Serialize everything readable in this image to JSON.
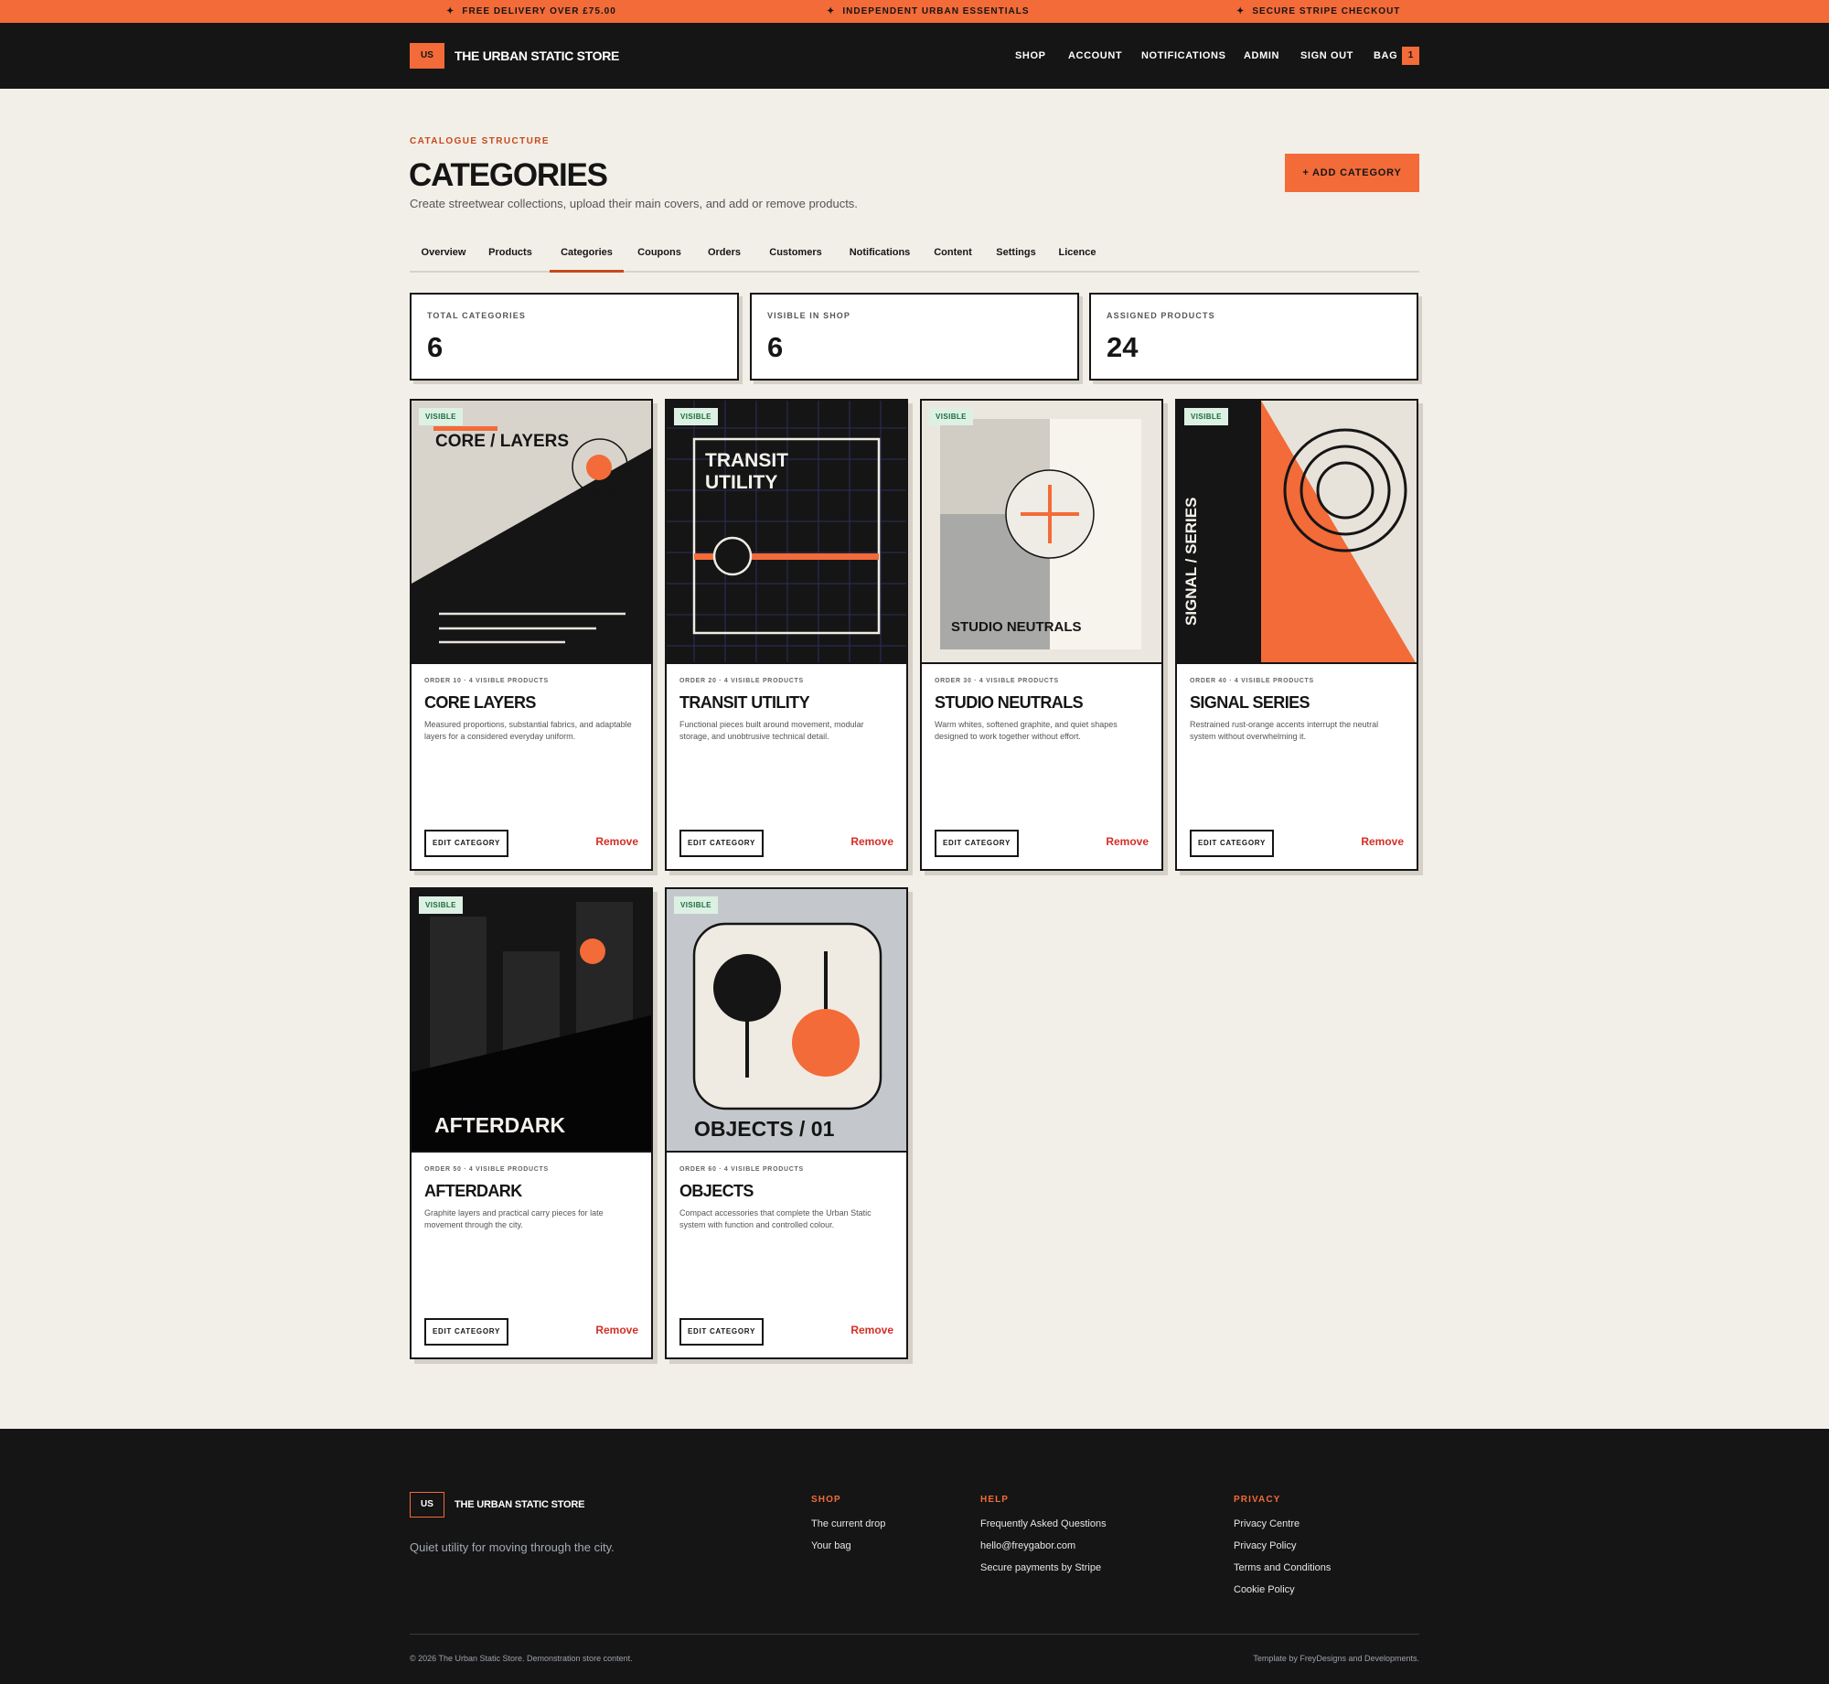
{
  "promo": {
    "items": [
      "FREE DELIVERY OVER £75.00",
      "INDEPENDENT URBAN ESSENTIALS",
      "SECURE STRIPE CHECKOUT"
    ],
    "star": "✦"
  },
  "header": {
    "logo_badge": "US",
    "store_name": "THE URBAN STATIC STORE",
    "nav": [
      "SHOP",
      "ACCOUNT",
      "NOTIFICATIONS",
      "ADMIN",
      "SIGN OUT",
      "BAG"
    ],
    "bag_count": "1"
  },
  "page": {
    "eyebrow": "CATALOGUE STRUCTURE",
    "title": "CATEGORIES",
    "subtitle": "Create streetwear collections, upload their main covers, and add or remove products.",
    "add_button": "+ ADD CATEGORY"
  },
  "tabs": [
    "Overview",
    "Products",
    "Categories",
    "Coupons",
    "Orders",
    "Customers",
    "Notifications",
    "Content",
    "Settings",
    "Licence"
  ],
  "active_tab": "Categories",
  "stats": [
    {
      "label": "TOTAL CATEGORIES",
      "value": "6"
    },
    {
      "label": "VISIBLE IN SHOP",
      "value": "6"
    },
    {
      "label": "ASSIGNED PRODUCTS",
      "value": "24"
    }
  ],
  "cards": [
    {
      "badge": "VISIBLE",
      "cover_text": "CORE / LAYERS",
      "meta": "ORDER 10 · 4 VISIBLE PRODUCTS",
      "title": "CORE LAYERS",
      "desc": "Measured proportions, substantial fabrics, and adaptable layers for a considered everyday uniform.",
      "edit": "EDIT CATEGORY",
      "remove": "Remove"
    },
    {
      "badge": "VISIBLE",
      "cover_text": "TRANSIT\nUTILITY",
      "meta": "ORDER 20 · 4 VISIBLE PRODUCTS",
      "title": "TRANSIT UTILITY",
      "desc": "Functional pieces built around movement, modular storage, and unobtrusive technical detail.",
      "edit": "EDIT CATEGORY",
      "remove": "Remove"
    },
    {
      "badge": "VISIBLE",
      "cover_text": "STUDIO NEUTRALS",
      "meta": "ORDER 30 · 4 VISIBLE PRODUCTS",
      "title": "STUDIO NEUTRALS",
      "desc": "Warm whites, softened graphite, and quiet shapes designed to work together without effort.",
      "edit": "EDIT CATEGORY",
      "remove": "Remove"
    },
    {
      "badge": "VISIBLE",
      "cover_text": "SIGNAL / SERIES",
      "meta": "ORDER 40 · 4 VISIBLE PRODUCTS",
      "title": "SIGNAL SERIES",
      "desc": "Restrained rust-orange accents interrupt the neutral system without overwhelming it.",
      "edit": "EDIT CATEGORY",
      "remove": "Remove"
    },
    {
      "badge": "VISIBLE",
      "cover_text": "AFTERDARK",
      "meta": "ORDER 50 · 4 VISIBLE PRODUCTS",
      "title": "AFTERDARK",
      "desc": "Graphite layers and practical carry pieces for late movement through the city.",
      "edit": "EDIT CATEGORY",
      "remove": "Remove"
    },
    {
      "badge": "VISIBLE",
      "cover_text": "OBJECTS / 01",
      "meta": "ORDER 60 · 4 VISIBLE PRODUCTS",
      "title": "OBJECTS",
      "desc": "Compact accessories that complete the Urban Static system with function and controlled colour.",
      "edit": "EDIT CATEGORY",
      "remove": "Remove"
    }
  ],
  "footer": {
    "logo_badge": "US",
    "store_name": "THE URBAN STATIC STORE",
    "tagline": "Quiet utility for moving through the city.",
    "shop": {
      "heading": "SHOP",
      "links": [
        "The current drop",
        "Your bag"
      ]
    },
    "help": {
      "heading": "HELP",
      "links": [
        "Frequently Asked Questions",
        "hello@freygabor.com",
        "Secure payments by Stripe"
      ]
    },
    "privacy": {
      "heading": "PRIVACY",
      "links": [
        "Privacy Centre",
        "Privacy Policy",
        "Terms and Conditions",
        "Cookie Policy"
      ]
    },
    "copyright": "© 2026 The Urban Static Store. Demonstration store content.",
    "credit": "Template by FreyDesigns and Developments."
  },
  "colors": {
    "accent": "#f26b38",
    "dark": "#151515",
    "background": "#f2efe8",
    "remove": "#d32f25",
    "visible_badge": "#dcf1e4"
  }
}
